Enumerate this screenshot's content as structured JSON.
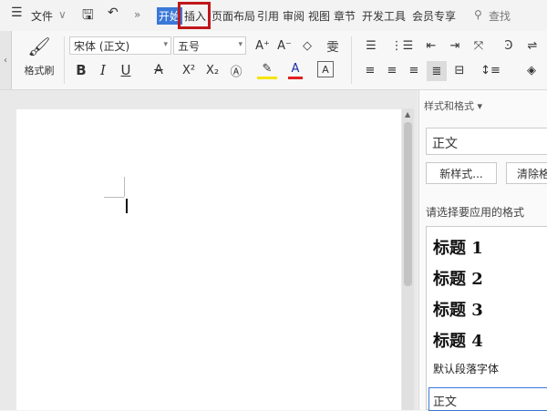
{
  "menubar": {
    "hamburger": "☰",
    "file_label": "文件",
    "file_arrow": "∨",
    "more": "»",
    "tabs": [
      "开始",
      "插入",
      "页面布局",
      "引用",
      "审阅",
      "视图",
      "章节",
      "开发工具",
      "会员专享"
    ],
    "search": "查找"
  },
  "ribbon": {
    "format_painter": "格式刷",
    "font_name": "宋体 (正文)",
    "font_size": "五号",
    "bold": "B",
    "italic": "I",
    "underline": "U",
    "strike": "A",
    "superscript": "X²",
    "subscript": "X₂",
    "grow": "A⁺",
    "shrink": "A⁻",
    "clear": "◇",
    "phonetic": "雯"
  },
  "panel": {
    "title": "样式和格式 ▾",
    "current_style": "正文",
    "new_style": "新样式...",
    "clear_format": "清除格",
    "hint": "请选择要应用的格式",
    "headings": [
      "标题 1",
      "标题 2",
      "标题 3",
      "标题 4"
    ],
    "default_font": "默认段落字体",
    "normal": "正文"
  }
}
